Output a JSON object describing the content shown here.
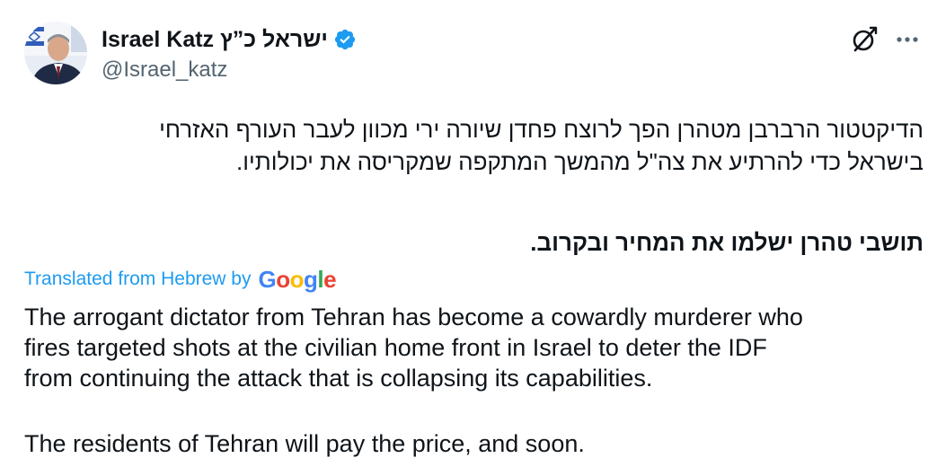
{
  "header": {
    "display_name": "ישראל כ”ץ Israel Katz",
    "handle": "@Israel_katz",
    "verified": true,
    "grok_icon": "grok-icon",
    "more_icon": "more-icon"
  },
  "hebrew": {
    "paragraph1_lines": [
      "הדיקטטור הרברבן מטהרן הפך לרוצח פחדן שיורה ירי מכוון לעבר העורף האזרחי",
      "בישראל כדי להרתיע את צה\"ל מהמשך המתקפה שמקריסה את יכולותיו."
    ],
    "paragraph2": "תושבי טהרן ישלמו את המחיר ובקרוב."
  },
  "translation": {
    "label": "Translated from Hebrew by",
    "provider": "Google",
    "paragraph1_lines": [
      "The arrogant dictator from Tehran has become a cowardly murderer who",
      "fires targeted shots at the civilian home front in Israel to deter the IDF",
      "from continuing the attack that is collapsing its capabilities."
    ],
    "paragraph2": "The residents of Tehran will pay the price, and soon."
  },
  "colors": {
    "accent": "#1d9bf0",
    "text": "#0f1419",
    "secondary": "#536471"
  }
}
